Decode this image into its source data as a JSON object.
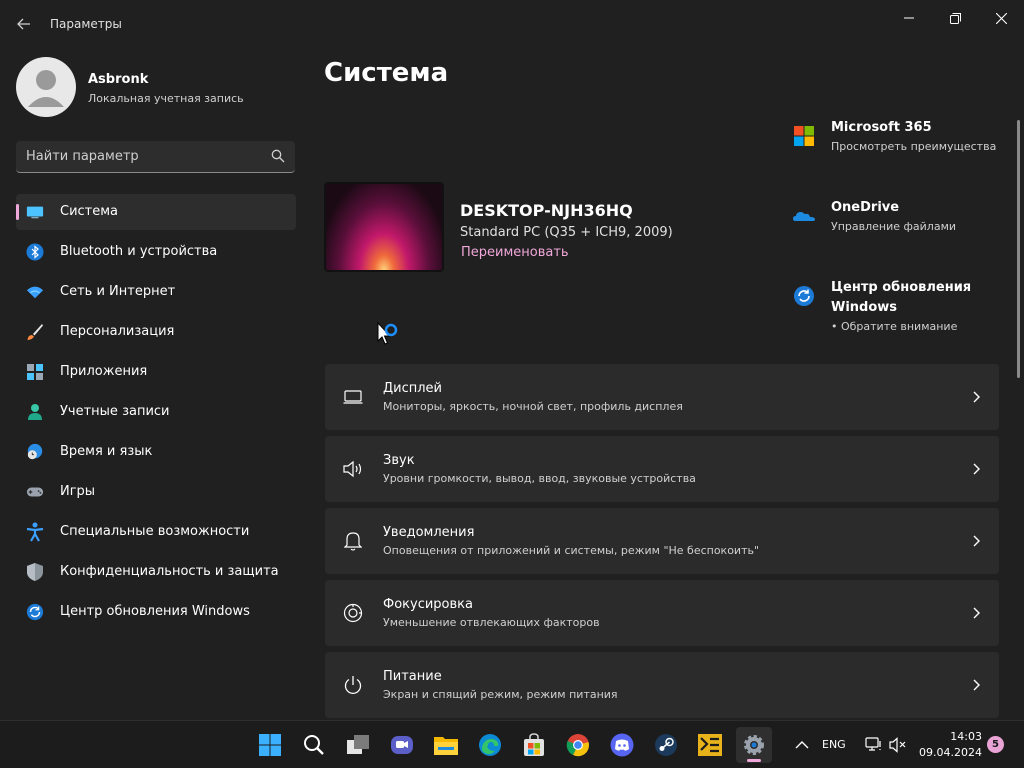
{
  "app": {
    "title": "Параметры"
  },
  "profile": {
    "name": "Asbronk",
    "account_type": "Локальная учетная запись"
  },
  "search": {
    "placeholder": "Найти параметр"
  },
  "nav": {
    "items": [
      {
        "label": "Система",
        "icon": "monitor-icon",
        "active": true
      },
      {
        "label": "Bluetooth и устройства",
        "icon": "bluetooth-icon"
      },
      {
        "label": "Сеть и Интернет",
        "icon": "wifi-icon"
      },
      {
        "label": "Персонализация",
        "icon": "brush-icon"
      },
      {
        "label": "Приложения",
        "icon": "apps-icon"
      },
      {
        "label": "Учетные записи",
        "icon": "person-icon"
      },
      {
        "label": "Время и язык",
        "icon": "globe-clock-icon"
      },
      {
        "label": "Игры",
        "icon": "gamepad-icon"
      },
      {
        "label": "Специальные возможности",
        "icon": "accessibility-icon"
      },
      {
        "label": "Конфиденциальность и защита",
        "icon": "shield-icon"
      },
      {
        "label": "Центр обновления Windows",
        "icon": "update-icon"
      }
    ]
  },
  "main": {
    "title": "Система",
    "device": {
      "name": "DESKTOP-NJH36HQ",
      "model": "Standard PC (Q35 + ICH9, 2009)",
      "rename_label": "Переименовать"
    },
    "quick_links": [
      {
        "title": "Microsoft 365",
        "subtitle": "Просмотреть преимущества",
        "icon": "microsoft365-icon"
      },
      {
        "title": "OneDrive",
        "subtitle": "Управление файлами",
        "icon": "onedrive-icon"
      },
      {
        "title": "Центр обновления Windows",
        "subtitle": "• Обратите внимание",
        "icon": "windows-update-icon"
      }
    ],
    "cards": [
      {
        "title": "Дисплей",
        "subtitle": "Мониторы, яркость, ночной свет, профиль дисплея",
        "icon": "display-icon"
      },
      {
        "title": "Звук",
        "subtitle": "Уровни громкости, вывод, ввод, звуковые устройства",
        "icon": "speaker-icon"
      },
      {
        "title": "Уведомления",
        "subtitle": "Оповещения от приложений и системы, режим \"Не беспокоить\"",
        "icon": "bell-icon"
      },
      {
        "title": "Фокусировка",
        "subtitle": "Уменьшение отвлекающих факторов",
        "icon": "focus-icon"
      },
      {
        "title": "Питание",
        "subtitle": "Экран и спящий режим, режим питания",
        "icon": "power-icon"
      }
    ]
  },
  "taskbar": {
    "apps": [
      "start-icon",
      "search-icon",
      "task-view-icon",
      "teams-icon",
      "explorer-icon",
      "edge-icon",
      "store-icon",
      "chrome-icon",
      "discord-icon",
      "steam-icon",
      "app-icon",
      "settings-icon"
    ],
    "tray": {
      "language": "ENG",
      "time": "14:03",
      "date": "09.04.2024",
      "notifications": "5"
    }
  },
  "colors": {
    "background": "#202020",
    "card": "#2b2b2b",
    "accent": "#f0a7d9"
  }
}
